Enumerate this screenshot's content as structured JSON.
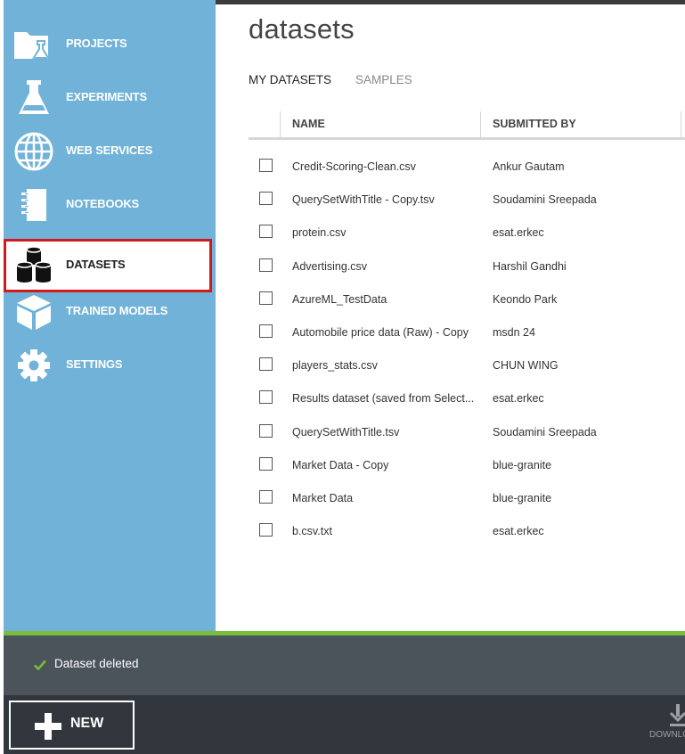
{
  "nav": {
    "items": [
      {
        "label": "PROJECTS",
        "icon": "folder-flask-icon",
        "active": false
      },
      {
        "label": "EXPERIMENTS",
        "icon": "flask-icon",
        "active": false
      },
      {
        "label": "WEB SERVICES",
        "icon": "globe-icon",
        "active": false
      },
      {
        "label": "NOTEBOOKS",
        "icon": "notebook-icon",
        "active": false
      },
      {
        "label": "DATASETS",
        "icon": "dataset-cylinders-icon",
        "active": true
      },
      {
        "label": "TRAINED MODELS",
        "icon": "cube-icon",
        "active": false
      },
      {
        "label": "SETTINGS",
        "icon": "gear-icon",
        "active": false
      }
    ]
  },
  "page": {
    "title": "datasets"
  },
  "tabs": [
    {
      "label": "MY DATASETS",
      "active": true
    },
    {
      "label": "SAMPLES",
      "active": false
    }
  ],
  "table": {
    "columns": [
      "NAME",
      "SUBMITTED BY"
    ],
    "rows": [
      {
        "name": "Credit-Scoring-Clean.csv",
        "submitted_by": "Ankur Gautam"
      },
      {
        "name": "QuerySetWithTitle - Copy.tsv",
        "submitted_by": "Soudamini Sreepada"
      },
      {
        "name": "protein.csv",
        "submitted_by": "esat.erkec"
      },
      {
        "name": "Advertising.csv",
        "submitted_by": "Harshil Gandhi"
      },
      {
        "name": "AzureML_TestData",
        "submitted_by": "Keondo Park"
      },
      {
        "name": "Automobile price data (Raw) - Copy",
        "submitted_by": "msdn 24"
      },
      {
        "name": "players_stats.csv",
        "submitted_by": "CHUN WING"
      },
      {
        "name": "Results dataset (saved from Select...",
        "submitted_by": "esat.erkec"
      },
      {
        "name": "QuerySetWithTitle.tsv",
        "submitted_by": "Soudamini Sreepada"
      },
      {
        "name": "Market Data - Copy",
        "submitted_by": "blue-granite"
      },
      {
        "name": "Market Data",
        "submitted_by": "blue-granite"
      },
      {
        "name": "b.csv.txt",
        "submitted_by": "esat.erkec"
      }
    ]
  },
  "status": {
    "message": "Dataset deleted",
    "icon": "checkmark-icon"
  },
  "commands": {
    "new_label": "NEW",
    "download_label": "DOWNLOAD"
  },
  "colors": {
    "sidebar": "#70b2d8",
    "active_border": "#d11b1b",
    "status_success": "#7bbd3a",
    "status_bar": "#4b535b",
    "command_bar": "#31373d"
  }
}
